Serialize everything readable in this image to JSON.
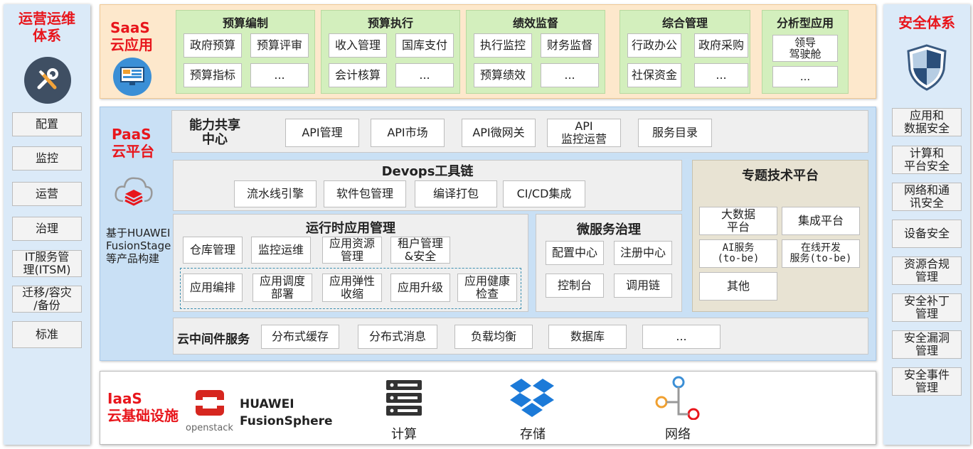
{
  "ops": {
    "title_l1": "运营运维",
    "title_l2": "体系",
    "items": [
      "配置",
      "监控",
      "运营",
      "治理",
      "IT服务管\n理(ITSM)",
      "迁移/容灾\n/备份",
      "标准"
    ]
  },
  "security": {
    "title": "安全体系",
    "items": [
      "应用和\n数据安全",
      "计算和\n平台安全",
      "网络和通\n讯安全",
      "设备安全",
      "资源合规\n管理",
      "安全补丁\n管理",
      "安全漏洞\n管理",
      "安全事件\n管理"
    ]
  },
  "saas": {
    "title_l1": "SaaS",
    "title_l2": "云应用",
    "groups": [
      {
        "title": "预算编制",
        "items": [
          "政府预算",
          "预算评审",
          "预算指标",
          "..."
        ]
      },
      {
        "title": "预算执行",
        "items": [
          "收入管理",
          "国库支付",
          "会计核算",
          "..."
        ]
      },
      {
        "title": "绩效监督",
        "items": [
          "执行监控",
          "财务监督",
          "预算绩效",
          "..."
        ]
      },
      {
        "title": "综合管理",
        "items": [
          "行政办公",
          "政府采购",
          "社保资金",
          "..."
        ]
      },
      {
        "title": "分析型应用",
        "items": [
          "领导\n驾驶舱",
          "..."
        ]
      }
    ]
  },
  "paas": {
    "title_l1": "PaaS",
    "title_l2": "云平台",
    "note": "基于HUAWEI\nFusionStage\n等产品构建",
    "capability": {
      "title": "能力共享\n中心",
      "items": [
        "API管理",
        "API市场",
        "API微网关",
        "API\n监控运营",
        "服务目录"
      ]
    },
    "devops": {
      "title": "Devops工具链",
      "items": [
        "流水线引擎",
        "软件包管理",
        "编译打包",
        "CI/CD集成"
      ]
    },
    "runtime": {
      "title": "运行时应用管理",
      "row1": [
        "仓库管理",
        "监控运维",
        "应用资源\n管理",
        "租户管理\n&安全"
      ],
      "row2": [
        "应用编排",
        "应用调度\n部署",
        "应用弹性\n收缩",
        "应用升级",
        "应用健康\n检查"
      ]
    },
    "micro": {
      "title": "微服务治理",
      "items": [
        "配置中心",
        "注册中心",
        "控制台",
        "调用链"
      ]
    },
    "topic": {
      "title": "专题技术平台",
      "items": [
        "大数据\n平台",
        "集成平台",
        "AI服务\n(to-be)",
        "在线开发\n服务(to-be)",
        "其他"
      ]
    },
    "middleware": {
      "title": "云中间件服务",
      "items": [
        "分布式缓存",
        "分布式消息",
        "负载均衡",
        "数据库",
        "..."
      ]
    }
  },
  "iaas": {
    "title_l1": "IaaS",
    "title_l2": "云基础设施",
    "openstack": "openstack",
    "product_l1": "HUAWEI",
    "product_l2": "FusionSphere",
    "items": [
      {
        "label": "计算",
        "icon": "server-icon"
      },
      {
        "label": "存储",
        "icon": "dropbox-icon"
      },
      {
        "label": "网络",
        "icon": "network-icon"
      }
    ]
  },
  "colors": {
    "accent_red": "#e8161c",
    "saas_bg": "#fde8cc",
    "paas_bg": "#c9e0f5",
    "green": "#d3efbd",
    "topic_bg": "#e8e3d3"
  }
}
